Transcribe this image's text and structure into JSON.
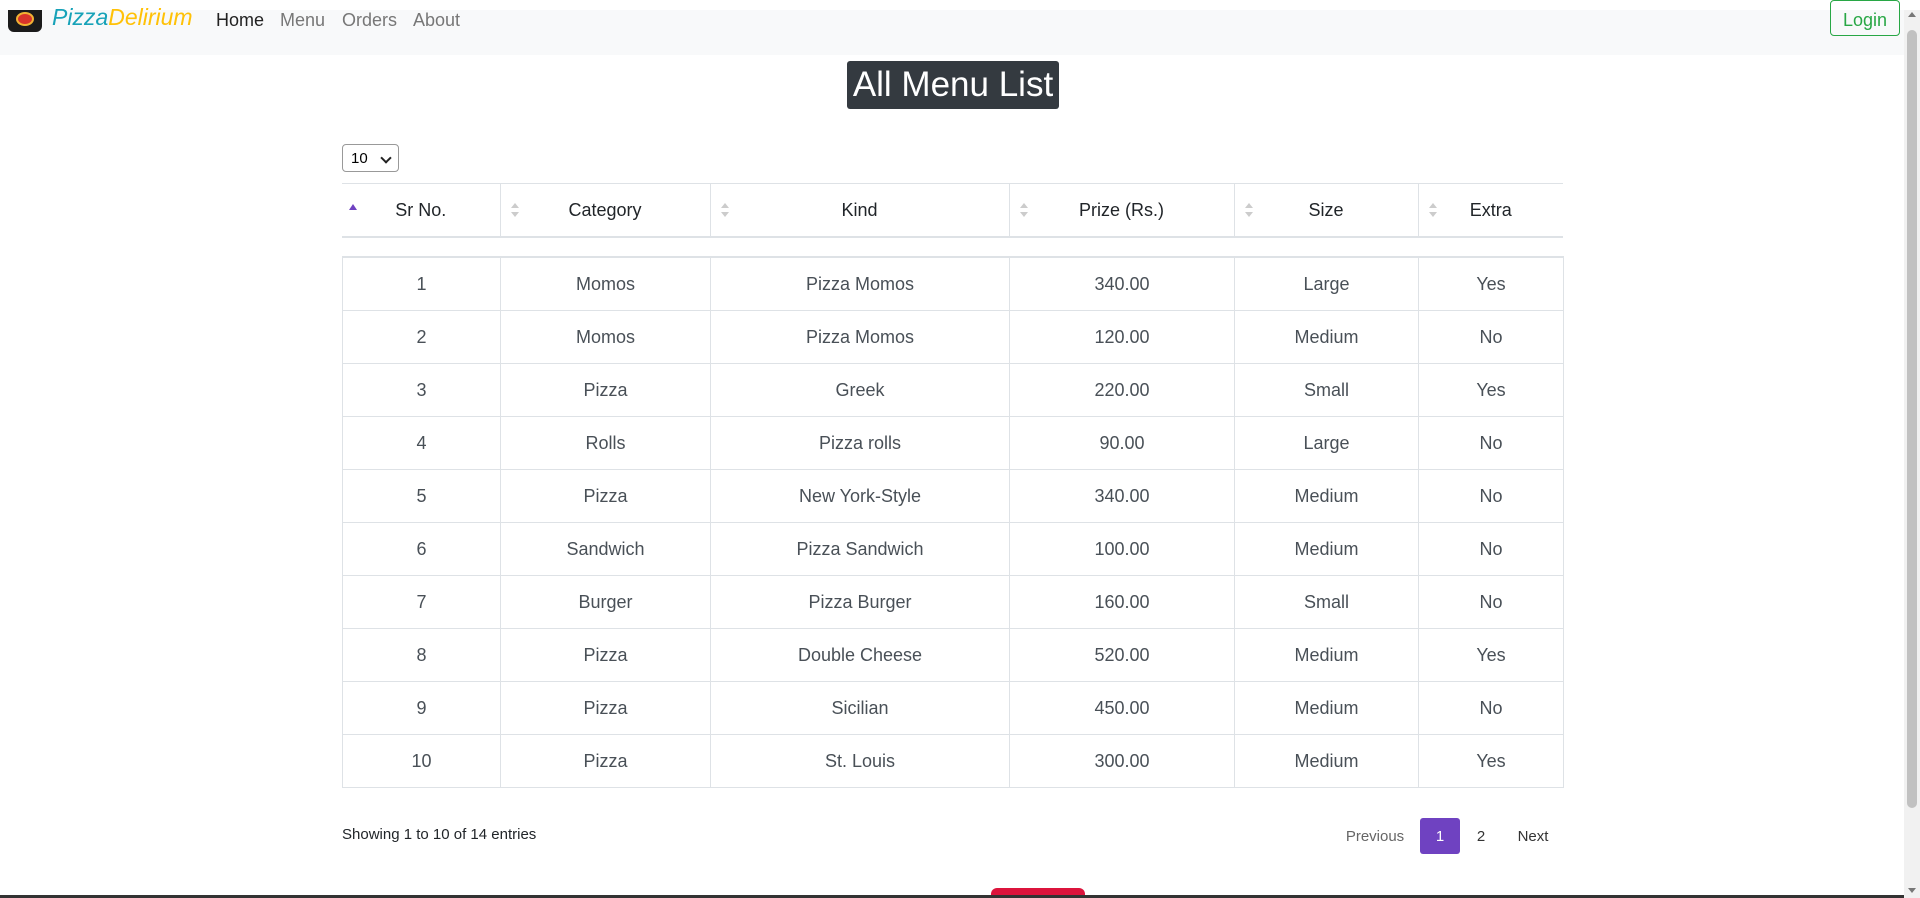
{
  "brand": {
    "part1": "Pizza",
    "part2": "Delirium"
  },
  "nav": {
    "home": "Home",
    "menu": "Menu",
    "orders": "Orders",
    "about": "About",
    "login": "Login"
  },
  "page_title": "All Menu List",
  "length_select": {
    "value": "10"
  },
  "table": {
    "headers": [
      "Sr No.",
      "Category",
      "Kind",
      "Prize (Rs.)",
      "Size",
      "Extra"
    ],
    "rows": [
      [
        "1",
        "Momos",
        "Pizza Momos",
        "340.00",
        "Large",
        "Yes"
      ],
      [
        "2",
        "Momos",
        "Pizza Momos",
        "120.00",
        "Medium",
        "No"
      ],
      [
        "3",
        "Pizza",
        "Greek",
        "220.00",
        "Small",
        "Yes"
      ],
      [
        "4",
        "Rolls",
        "Pizza rolls",
        "90.00",
        "Large",
        "No"
      ],
      [
        "5",
        "Pizza",
        "New York-Style",
        "340.00",
        "Medium",
        "No"
      ],
      [
        "6",
        "Sandwich",
        "Pizza Sandwich",
        "100.00",
        "Medium",
        "No"
      ],
      [
        "7",
        "Burger",
        "Pizza Burger",
        "160.00",
        "Small",
        "No"
      ],
      [
        "8",
        "Pizza",
        "Double Cheese",
        "520.00",
        "Medium",
        "Yes"
      ],
      [
        "9",
        "Pizza",
        "Sicilian",
        "450.00",
        "Medium",
        "No"
      ],
      [
        "10",
        "Pizza",
        "St. Louis",
        "300.00",
        "Medium",
        "Yes"
      ]
    ]
  },
  "info": "Showing 1 to 10 of 14 entries",
  "pagination": {
    "previous": "Previous",
    "pages": [
      "1",
      "2"
    ],
    "next": "Next",
    "active_page": "1"
  },
  "colors": {
    "accent": "#6f42c1",
    "brand_primary": "#17a2b8",
    "brand_secondary": "#ffc107",
    "login": "#28a745",
    "title_bg": "#343a40"
  }
}
